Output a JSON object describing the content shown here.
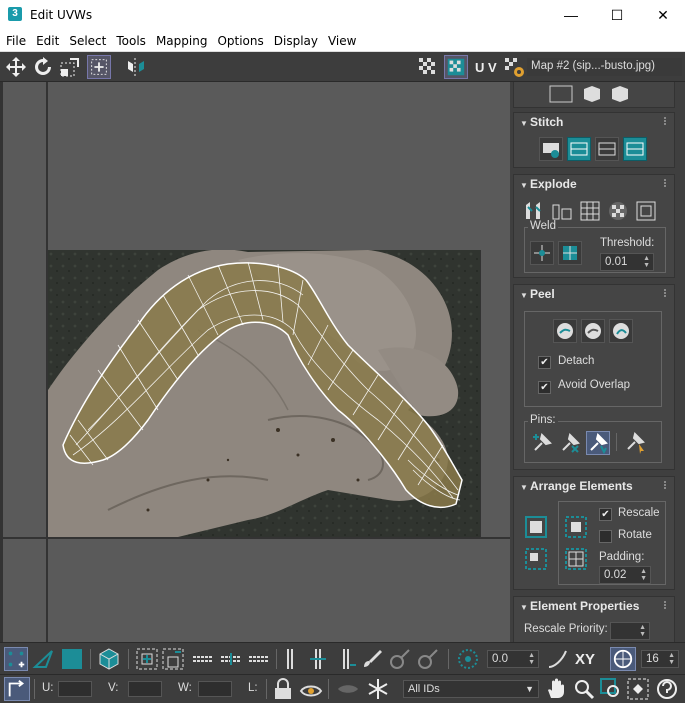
{
  "window": {
    "title": "Edit UVWs",
    "app_icon": "3",
    "minimize": "—",
    "maximize": "☐",
    "close": "✕"
  },
  "menu": [
    "File",
    "Edit",
    "Select",
    "Tools",
    "Mapping",
    "Options",
    "Display",
    "View"
  ],
  "toolbar": {
    "uv_label": "U V",
    "map_selector": "Map #2 (sip...-busto.jpg)"
  },
  "panel": {
    "stitch": {
      "title": "Stitch"
    },
    "explode": {
      "title": "Explode",
      "weld_label": "Weld",
      "threshold_label": "Threshold:",
      "threshold_value": "0.01"
    },
    "peel": {
      "title": "Peel",
      "detach_label": "Detach",
      "detach_checked": true,
      "avoid_overlap_label": "Avoid Overlap",
      "avoid_overlap_checked": true,
      "pins_label": "Pins:"
    },
    "arrange": {
      "title": "Arrange Elements",
      "rescale_label": "Rescale",
      "rescale_checked": true,
      "rotate_label": "Rotate",
      "rotate_checked": false,
      "padding_label": "Padding:",
      "padding_value": "0.02"
    },
    "element_props": {
      "title": "Element Properties",
      "rescale_priority_label": "Rescale Priority:"
    }
  },
  "bottom": {
    "angle_value": "0.0",
    "xy_label": "XY",
    "grid_value": "16",
    "u_label": "U:",
    "v_label": "V:",
    "w_label": "W:",
    "l_label": "L:",
    "id_filter": "All IDs"
  },
  "colors": {
    "accent": "#1c8d97",
    "mesh": "#ffffff",
    "mesh_fill": "#8a7a4a"
  }
}
